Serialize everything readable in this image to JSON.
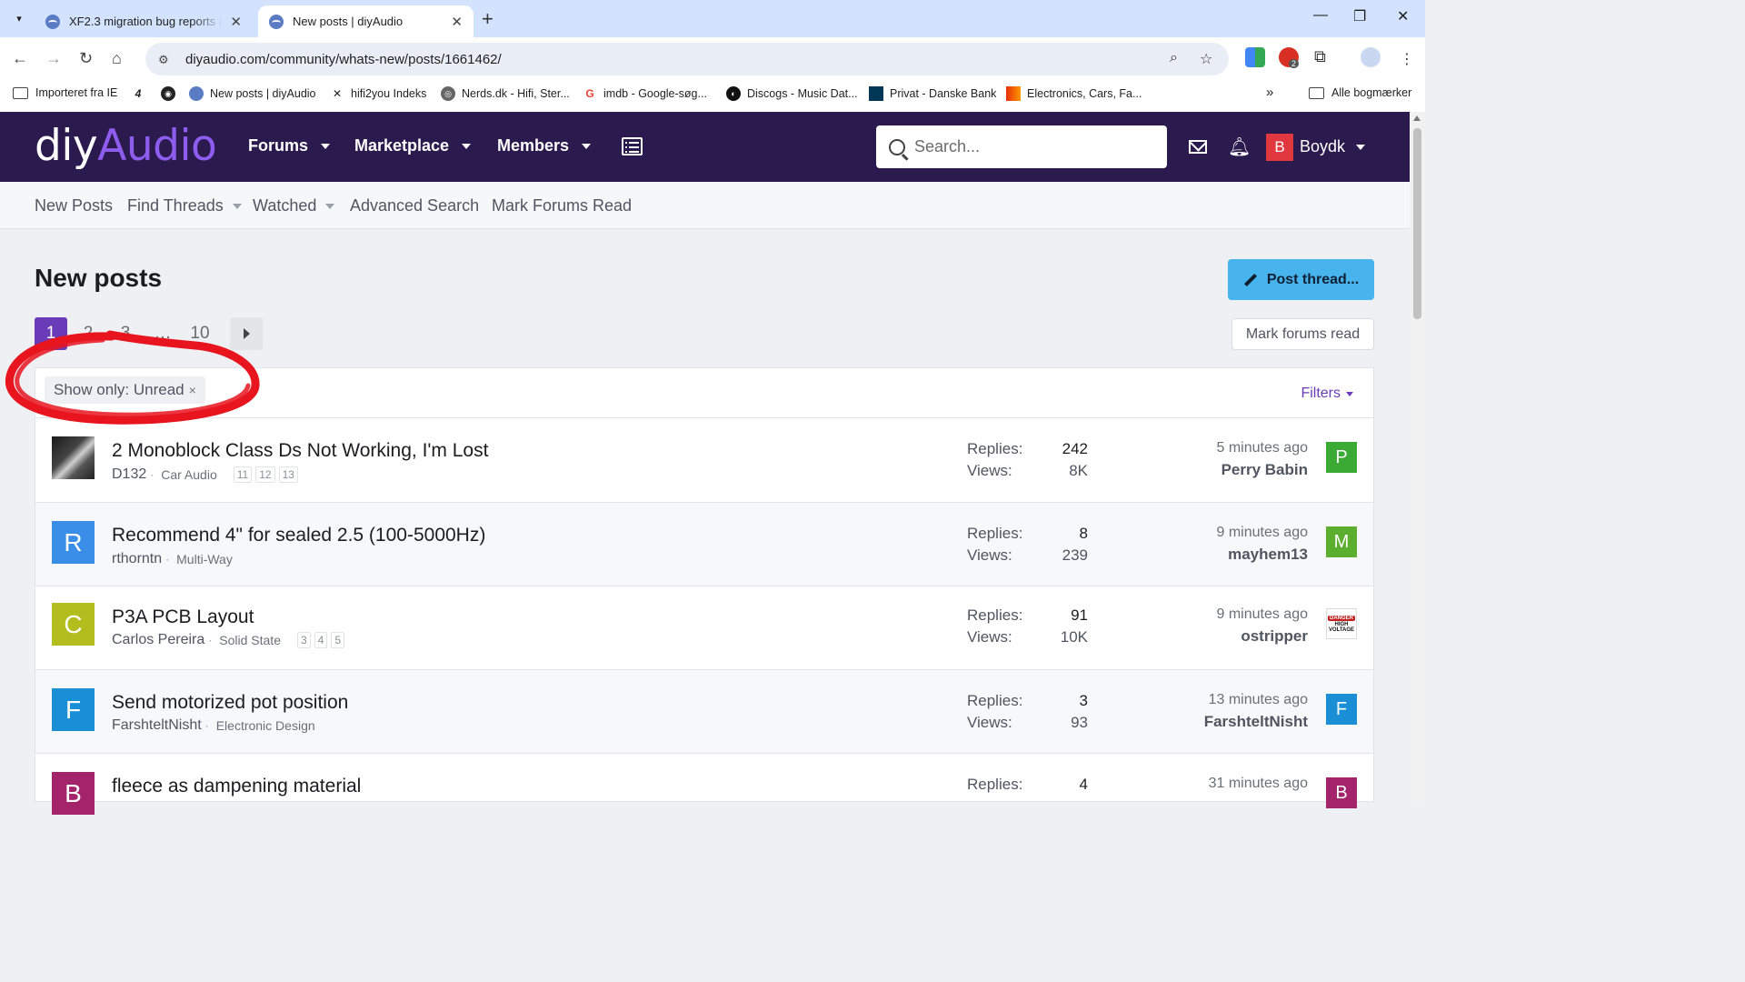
{
  "browser": {
    "tabs": [
      {
        "title": "XF2.3 migration bug reports | d",
        "close": "✕"
      },
      {
        "title": "New posts | diyAudio",
        "close": "✕"
      }
    ],
    "new_tab": "+",
    "window_controls": {
      "minimize": "—",
      "restore": "❐",
      "close": "✕"
    },
    "url": "diyaudio.com/community/whats-new/posts/1661462/",
    "bookmarks": [
      {
        "label": "Importeret fra IE",
        "icon": "folder-icon"
      },
      {
        "label": "",
        "icon": "4-icon"
      },
      {
        "label": "",
        "icon": "disc-icon"
      },
      {
        "label": "New posts | diyAudio",
        "icon": "diyaudio-icon"
      },
      {
        "label": "hifi2you Indeks",
        "icon": "hifi2you-icon"
      },
      {
        "label": "Nerds.dk - Hifi, Ster...",
        "icon": "nerds-icon"
      },
      {
        "label": "imdb - Google-søg...",
        "icon": "google-icon"
      },
      {
        "label": "Discogs - Music Dat...",
        "icon": "discogs-icon"
      },
      {
        "label": "Privat - Danske Bank",
        "icon": "bank-icon"
      },
      {
        "label": "Electronics, Cars, Fa...",
        "icon": "aliexpress-icon"
      }
    ],
    "overflow": "»",
    "all_bookmarks": "Alle bogmærker",
    "extension_badge": "2"
  },
  "site": {
    "logo_diy": "diy",
    "logo_audio": "Audio",
    "nav": [
      "Forums",
      "Marketplace",
      "Members"
    ],
    "search_placeholder": "Search...",
    "username": "Boydk",
    "user_initial": "B",
    "subnav": [
      "New Posts",
      "Find Threads",
      "Watched",
      "Advanced Search",
      "Mark Forums Read"
    ]
  },
  "page": {
    "title": "New posts",
    "post_thread": "Post thread...",
    "mark_forums_read": "Mark forums read",
    "pagination": [
      "1",
      "2",
      "3",
      "…",
      "10"
    ],
    "current_page": "1",
    "filter_chip": "Show only: Unread",
    "filter_chip_remove": "×",
    "filters_link": "Filters"
  },
  "threads": [
    {
      "title": "2 Monoblock Class Ds Not Working, I'm Lost",
      "author": "D132",
      "forum": "Car Audio",
      "pages": [
        "11",
        "12",
        "13"
      ],
      "replies": "242",
      "views": "8K",
      "time": "5 minutes ago",
      "last_user": "Perry Babin",
      "avatar": "",
      "avatar_color": "#333333",
      "last_initial": "P",
      "last_color": "#3aaa35"
    },
    {
      "title": "Recommend 4\" for sealed 2.5 (100-5000Hz)",
      "author": "rthorntn",
      "forum": "Multi-Way",
      "pages": [],
      "replies": "8",
      "views": "239",
      "time": "9 minutes ago",
      "last_user": "mayhem13",
      "avatar": "R",
      "avatar_color": "#3b8ee8",
      "last_initial": "M",
      "last_color": "#5cae2e"
    },
    {
      "title": "P3A PCB Layout",
      "author": "Carlos Pereira",
      "forum": "Solid State",
      "pages": [
        "3",
        "4",
        "5"
      ],
      "replies": "91",
      "views": "10K",
      "time": "9 minutes ago",
      "last_user": "ostripper",
      "avatar": "C",
      "avatar_color": "#b3bd1e",
      "last_initial": "",
      "last_color": "#ffffff"
    },
    {
      "title": "Send motorized pot position",
      "author": "FarshteltNisht",
      "forum": "Electronic Design",
      "pages": [],
      "replies": "3",
      "views": "93",
      "time": "13 minutes ago",
      "last_user": "FarshteltNisht",
      "avatar": "F",
      "avatar_color": "#1a8fd6",
      "last_initial": "F",
      "last_color": "#1a8fd6"
    },
    {
      "title": "fleece as dampening material",
      "author": "",
      "forum": "",
      "pages": [],
      "replies": "4",
      "views": "",
      "time": "31 minutes ago",
      "last_user": "",
      "avatar": "B",
      "avatar_color": "#a3246b",
      "last_initial": "B",
      "last_color": "#a3246b"
    }
  ],
  "labels": {
    "replies": "Replies:",
    "views": "Views:"
  },
  "danger_badge": {
    "line1": "DANGER",
    "line2": "HIGH",
    "line3": "VOLTAGE"
  },
  "colors": {
    "header_bg": "#2b1a4d",
    "accent": "#6a3bb8",
    "post_button": "#47b4ee",
    "annotation": "#e8141e"
  }
}
